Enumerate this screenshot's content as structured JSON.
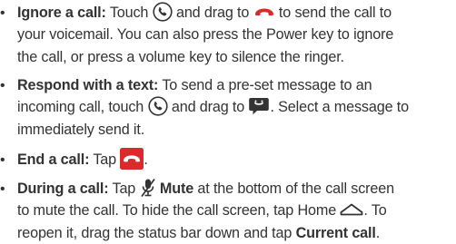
{
  "bullet_char": "•",
  "colors": {
    "text": "#333333",
    "accent_red": "#d92b2b",
    "icon_stroke": "#333333"
  },
  "icons": {
    "answer": "phone-answer-circle-icon",
    "end": "phone-end-red-icon",
    "message": "speech-bubble-icon",
    "mute": "microphone-mute-icon",
    "home": "home-icon",
    "end_button": "end-call-button-icon"
  },
  "items": [
    {
      "term": "Ignore a call:",
      "l1_a": " Touch ",
      "l1_b": " and drag to ",
      "l1_c": " to send the call to",
      "l2": "your voicemail. You can also press the Power key to ignore",
      "l3": "the call, or press a volume key to silence the ringer."
    },
    {
      "term": "Respond with a text:",
      "l1_a": " To send a pre-set message to an",
      "l2_a": "incoming call, touch ",
      "l2_b": " and drag to ",
      "l2_c": ". Select a message to",
      "l3": "immediately send it."
    },
    {
      "term": "End a call:",
      "l1_a": " Tap ",
      "l1_b": "."
    },
    {
      "term": "During a call:",
      "l1_a": " Tap ",
      "l1_b": "Mute",
      "l1_c": " at the bottom of the call screen",
      "l2": "to mute the call. To hide the call screen, tap Home ",
      "l2_b": ". To",
      "l3_a": "reopen it, drag the status bar down and tap ",
      "l3_b": "Current call",
      "l3_c": "."
    }
  ]
}
